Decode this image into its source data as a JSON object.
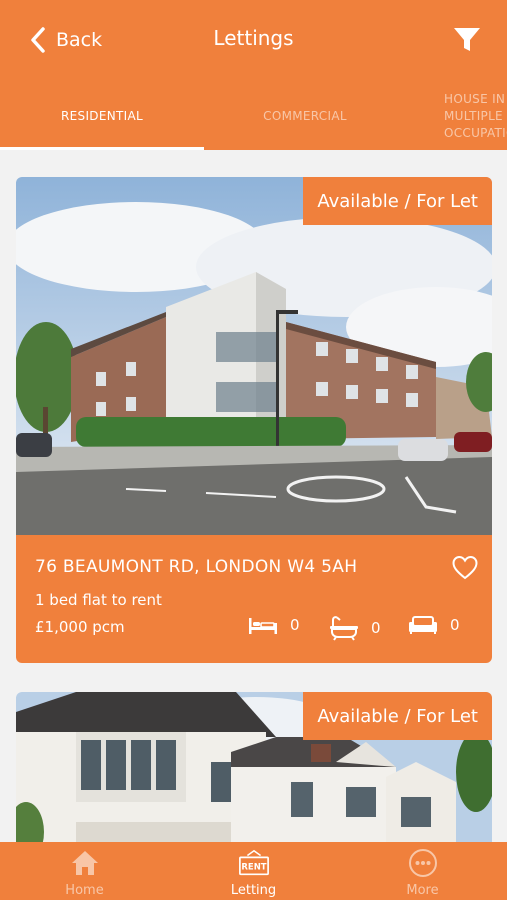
{
  "header": {
    "back_label": "Back",
    "title": "Lettings",
    "icons": {
      "back": "chevron-left-icon",
      "filter": "filter-icon"
    }
  },
  "tabs": [
    {
      "label": "RESIDENTIAL",
      "active": true
    },
    {
      "label": "COMMERCIAL",
      "active": false
    },
    {
      "label": "HOUSE IN MULTIPLE OCCUPATION",
      "active": false
    }
  ],
  "listings": [
    {
      "badge": "Available / For Let",
      "address": "76 BEAUMONT RD, LONDON W4 5AH",
      "description": "1 bed flat to rent",
      "price": "£1,000 pcm",
      "bedrooms": "0",
      "bathrooms": "0",
      "receptions": "0"
    },
    {
      "badge": "Available / For Let"
    }
  ],
  "bottom_nav": [
    {
      "label": "Home",
      "icon": "home-icon",
      "active": false
    },
    {
      "label": "Letting",
      "icon": "rent-sign-icon",
      "active": true,
      "icon_text": "RENT"
    },
    {
      "label": "More",
      "icon": "more-icon",
      "active": false
    }
  ],
  "colors": {
    "accent": "#f0803c",
    "background": "#f2f2f2",
    "text_on_accent": "#ffffff"
  }
}
